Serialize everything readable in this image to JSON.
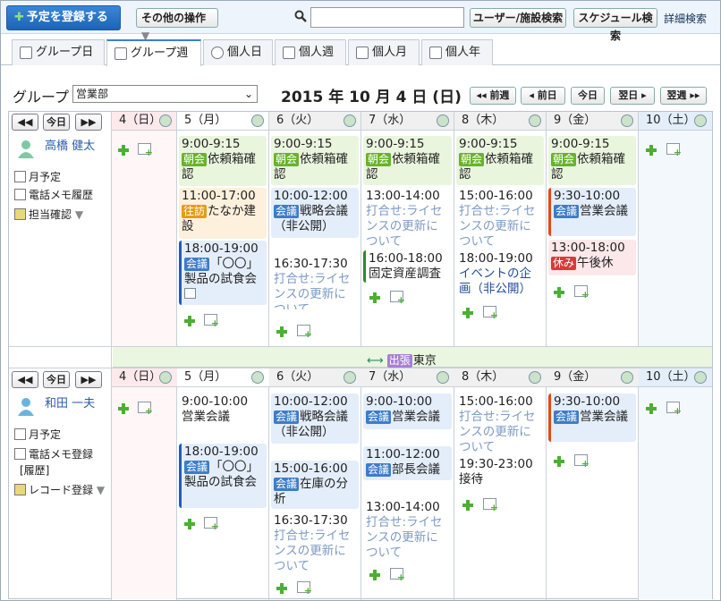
{
  "toolbar": {
    "register": "予定を登録する",
    "other_ops": "その他の操作",
    "user_search": "ユーザー/施設検索",
    "schedule_search": "スケジュール検索",
    "detail_search": "詳細検索",
    "search_placeholder": ""
  },
  "tabs": [
    "グループ日",
    "グループ週",
    "個人日",
    "個人週",
    "個人月",
    "個人年"
  ],
  "group": {
    "label": "グループ",
    "selected": "営業部"
  },
  "date_heading": "2015 年 10 月 4 日 (日)",
  "nav": {
    "prev_week": "前週",
    "prev_day": "前日",
    "today": "今日",
    "next_day": "翌日",
    "next_week": "翌週"
  },
  "mininav": {
    "prev": "◀◀",
    "today": "今日",
    "next": "▶▶"
  },
  "days": [
    "4（日）",
    "5（月）",
    "6（火）",
    "7（水）",
    "8（木）",
    "9（金）",
    "10（土）"
  ],
  "user1": {
    "name": "高橋 健太",
    "links": [
      "月予定",
      "電話メモ履歴",
      "担当確認"
    ],
    "e": {
      "d1a_time": "9:00-9:15",
      "d1a_tag": "朝会",
      "d1a_title": "依頼箱確認",
      "d1b_time": "11:00-17:00",
      "d1b_tag": "往訪",
      "d1b_title": "たなか建設",
      "d1c_time": "18:00-19:00",
      "d1c_tag": "会議",
      "d1c_title": "「〇〇」製品の試食会",
      "d2a_time": "9:00-9:15",
      "d2a_tag": "朝会",
      "d2a_title": "依頼箱確認",
      "d2b_time": "10:00-12:00",
      "d2b_tag": "会議",
      "d2b_title": "戦略会議（非公開）",
      "d2c_time": "16:30-17:30",
      "d2c_title": "打合せ:ライセンスの更新について",
      "d3a_time": "9:00-9:15",
      "d3a_tag": "朝会",
      "d3a_title": "依頼箱確認",
      "d3b_time": "13:00-14:00",
      "d3b_title": "打合せ:ライセンスの更新について",
      "d3c_time": "16:00-18:00",
      "d3c_title": "固定資産調査",
      "d4a_time": "9:00-9:15",
      "d4a_tag": "朝会",
      "d4a_title": "依頼箱確認",
      "d4b_time": "15:00-16:00",
      "d4b_title": "打合せ:ライセンスの更新について",
      "d4c_time": "18:00-19:00",
      "d4c_title": "イベントの企画（非公開）",
      "d5a_time": "9:00-9:15",
      "d5a_tag": "朝会",
      "d5a_title": "依頼箱確認",
      "d5b_time": "9:30-10:00",
      "d5b_tag": "会議",
      "d5b_title": "営業会議",
      "d5c_time": "13:00-18:00",
      "d5c_tag": "休み",
      "d5c_title": "午後休"
    }
  },
  "banner": {
    "tag": "出張",
    "title": "東京"
  },
  "user2": {
    "name": "和田 一夫",
    "links": [
      "月予定",
      "電話メモ登録",
      "[履歴]",
      "レコード登録"
    ],
    "e": {
      "d1a_time": "9:00-10:00",
      "d1a_title": "営業会議",
      "d1b_time": "18:00-19:00",
      "d1b_tag": "会議",
      "d1b_title": "「〇〇」製品の試食会",
      "d2a_time": "10:00-12:00",
      "d2a_tag": "会議",
      "d2a_title": "戦略会議（非公開）",
      "d2b_time": "15:00-16:00",
      "d2b_tag": "会議",
      "d2b_title": "在庫の分析",
      "d2c_time": "16:30-17:30",
      "d2c_title": "打合せ:ライセンスの更新について",
      "d3a_time": "9:00-10:00",
      "d3a_tag": "会議",
      "d3a_title": "営業会議",
      "d3b_time": "11:00-12:00",
      "d3b_tag": "会議",
      "d3b_title": "部長会議",
      "d3c_time": "13:00-14:00",
      "d3c_title": "打合せ:ライセンスの更新について",
      "d4a_time": "15:00-16:00",
      "d4a_title": "打合せ:ライセンスの更新について",
      "d4b_time": "19:30-23:00",
      "d4b_title": "接待",
      "d5a_time": "9:30-10:00",
      "d5a_tag": "会議",
      "d5a_title": "営業会議"
    }
  }
}
